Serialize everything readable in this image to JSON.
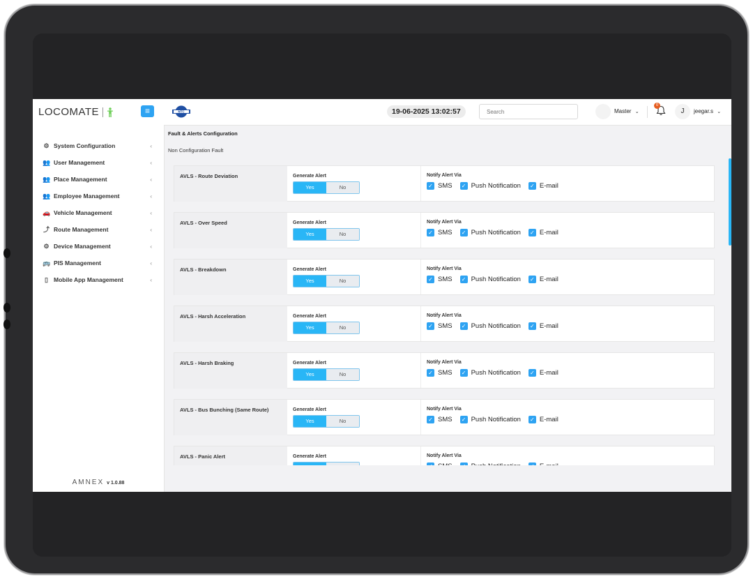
{
  "sidebar": {
    "logo_text": "LOCOMATE",
    "menu_icon": "hamburger-icon",
    "items": [
      {
        "label": "System Configuration",
        "icon": "gear-cluster-icon"
      },
      {
        "label": "User Management",
        "icon": "users-icon"
      },
      {
        "label": "Place Management",
        "icon": "users-icon"
      },
      {
        "label": "Employee Management",
        "icon": "users-icon"
      },
      {
        "label": "Vehicle Management",
        "icon": "car-icon"
      },
      {
        "label": "Route Management",
        "icon": "route-icon"
      },
      {
        "label": "Device Management",
        "icon": "gear-cluster-icon"
      },
      {
        "label": "PIS Management",
        "icon": "bus-icon"
      },
      {
        "label": "Mobile App Management",
        "icon": "mobile-icon"
      }
    ],
    "footer_brand": "AMNEX",
    "version": "v 1.0.88"
  },
  "header": {
    "brand_badge": "MTC",
    "datetime": "19-06-2025 13:02:57",
    "search_placeholder": "Search",
    "role_label": "Master",
    "notification_count": "0",
    "user_initial": "J",
    "username": "jeegar.s"
  },
  "main": {
    "page_title": "Fault & Alerts Configuration",
    "section_title": "Non Configuration Fault",
    "generate_alert_label": "Generate Alert",
    "notify_label": "Notify Alert Via",
    "yes_label": "Yes",
    "no_label": "No",
    "channels": [
      "SMS",
      "Push Notification",
      "E-mail"
    ],
    "faults": [
      {
        "name": "AVLS - Route Deviation",
        "alert": "Yes"
      },
      {
        "name": "AVLS - Over Speed",
        "alert": "Yes"
      },
      {
        "name": "AVLS - Breakdown",
        "alert": "Yes"
      },
      {
        "name": "AVLS - Harsh Acceleration",
        "alert": "Yes"
      },
      {
        "name": "AVLS - Harsh Braking",
        "alert": "Yes"
      },
      {
        "name": "AVLS - Bus Bunching (Same Route)",
        "alert": "Yes"
      },
      {
        "name": "AVLS - Panic Alert",
        "alert": "Yes"
      }
    ]
  },
  "colors": {
    "accent": "#29b6f6",
    "badge": "#e65c1e"
  }
}
